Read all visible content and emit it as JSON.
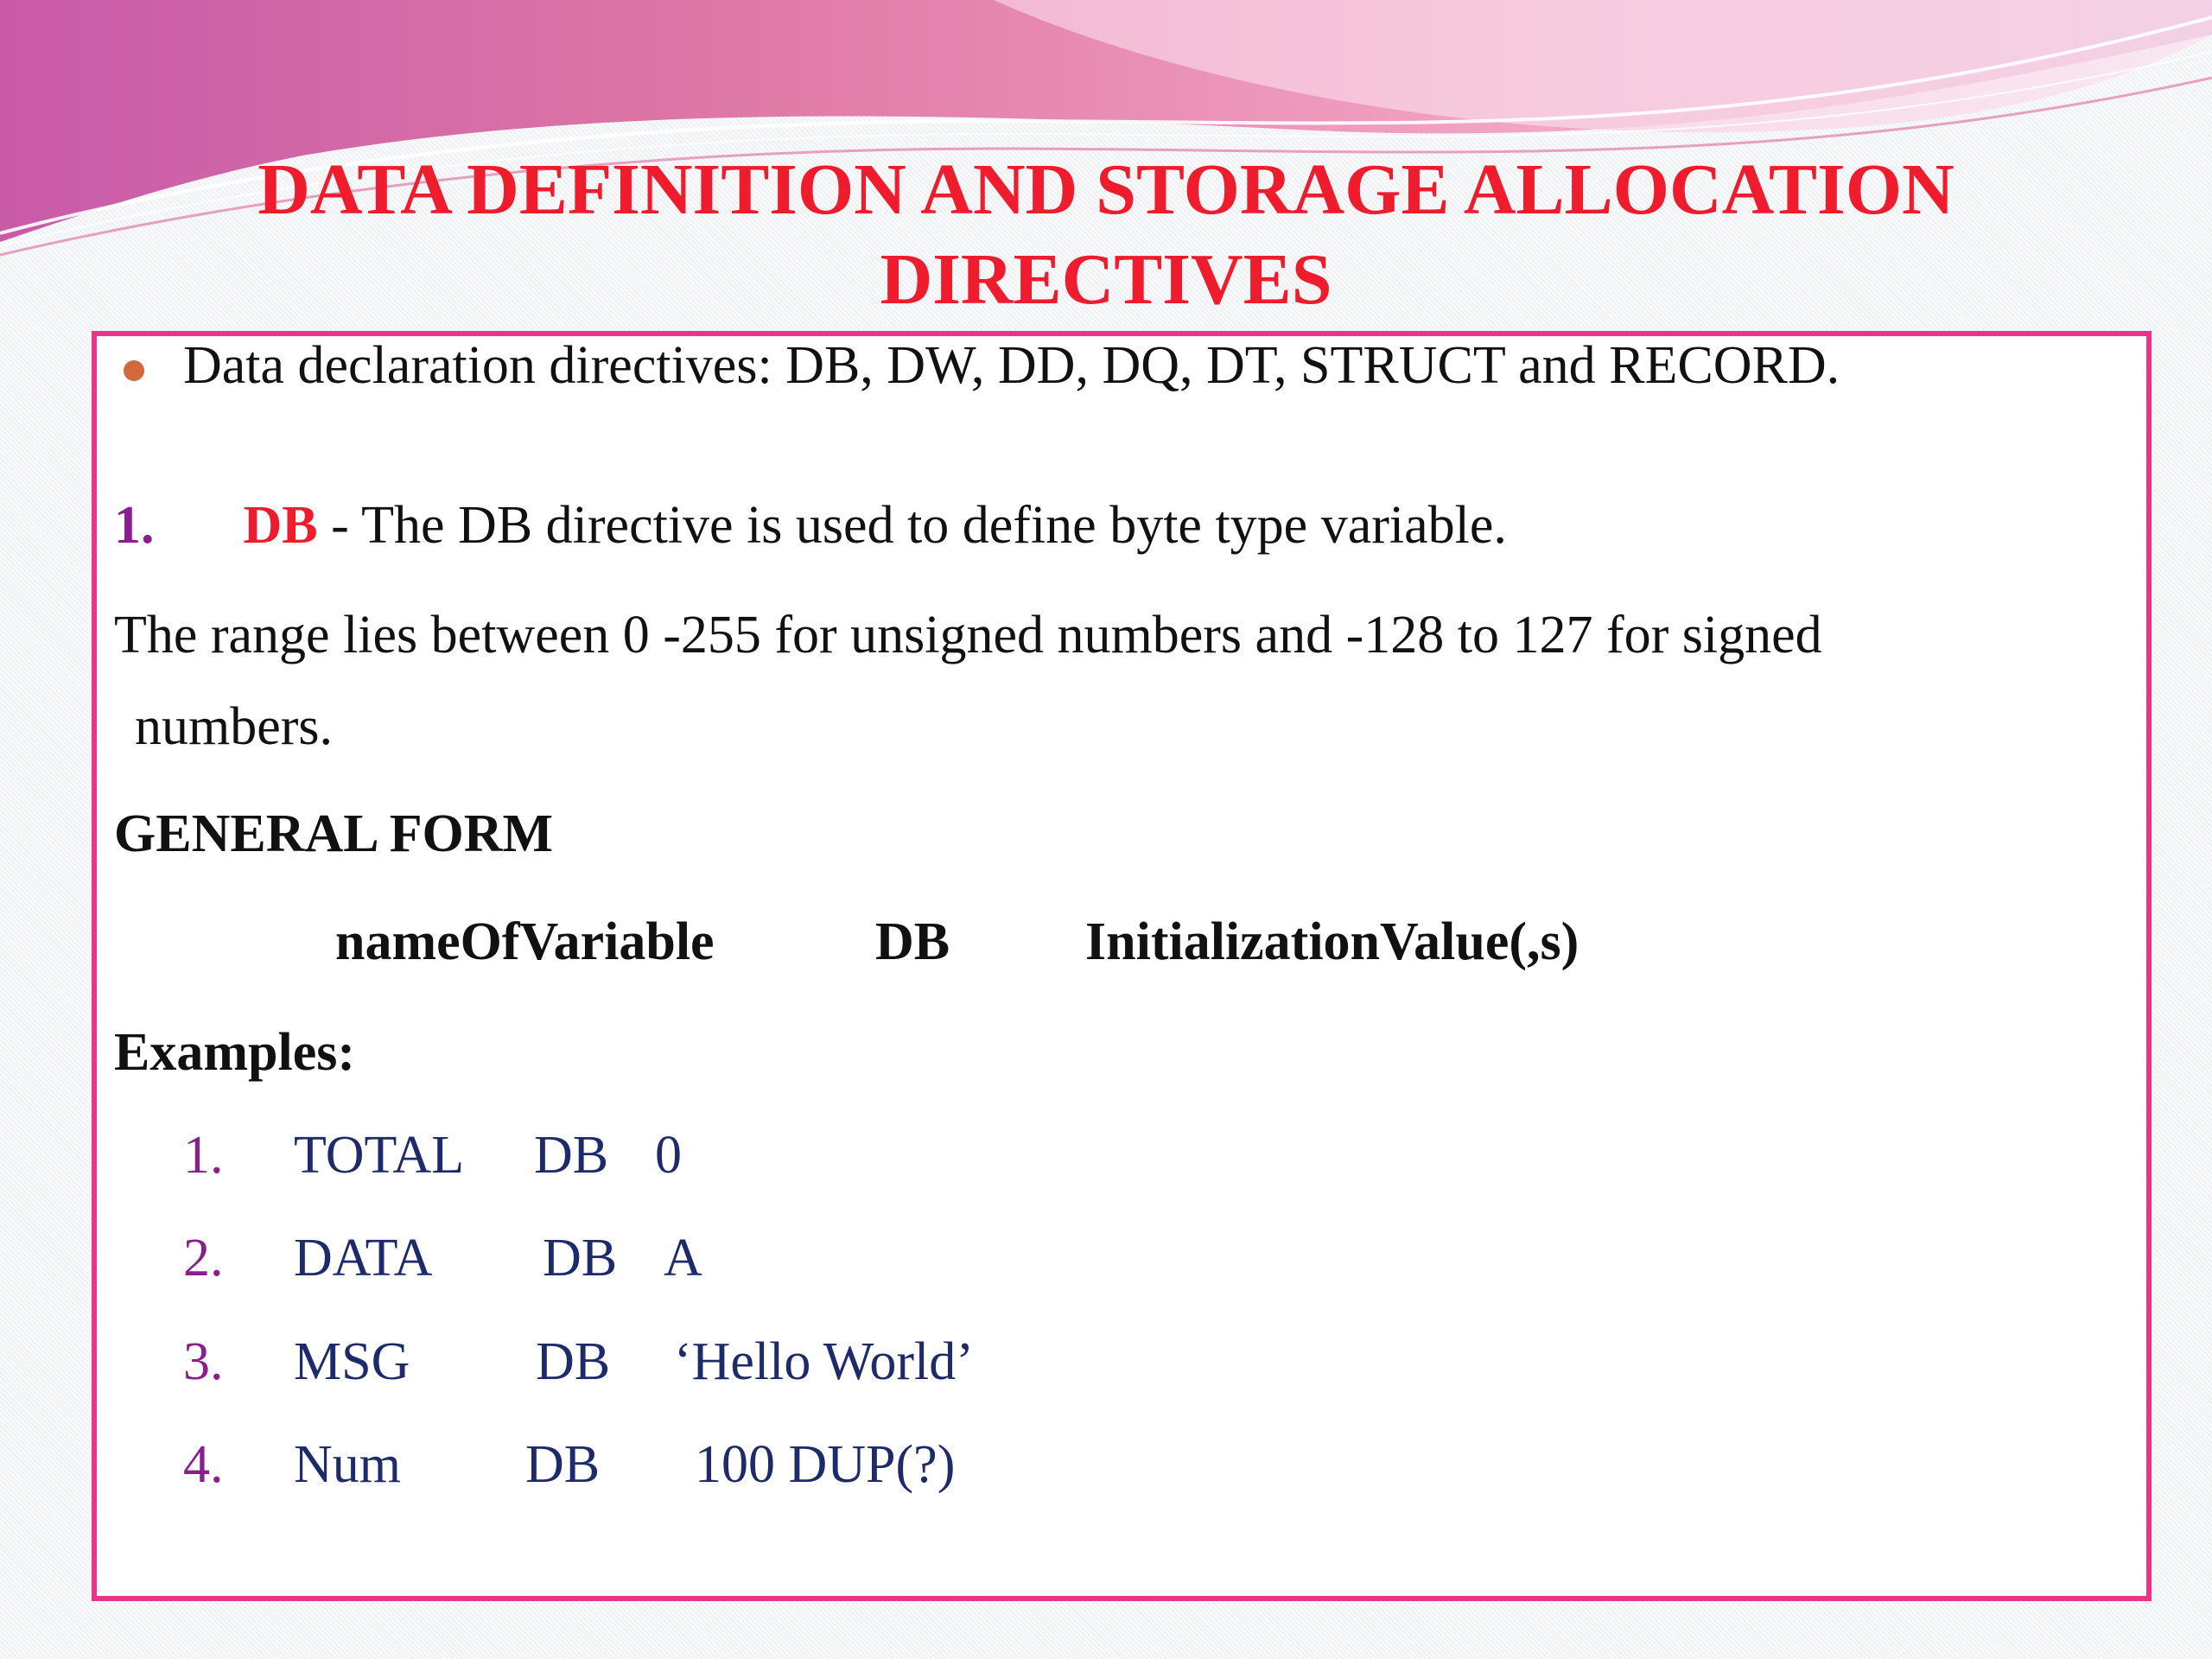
{
  "title": {
    "line1": "DATA DEFINITION AND STORAGE ALLOCATION",
    "line2": "DIRECTIVES"
  },
  "bullet": {
    "text": "Data declaration directives: DB, DW, DD, DQ, DT, STRUCT and RECORD."
  },
  "item1": {
    "number": "1.",
    "keyword": "DB",
    "description": " - The DB directive is used to define byte type variable."
  },
  "range": {
    "line1": "The range lies between 0 -255 for unsigned numbers and -128 to 127 for signed",
    "line2": "numbers."
  },
  "general_form": {
    "heading": "GENERAL FORM",
    "name": "nameOfVariable",
    "directive": "DB",
    "value": "InitializationValue(,s)"
  },
  "examples": {
    "heading": "Examples:",
    "items": [
      {
        "num": "1.",
        "name": "TOTAL",
        "directive": "DB",
        "value": "0"
      },
      {
        "num": "2.",
        "name": "DATA",
        "directive": "DB",
        "value": "A"
      },
      {
        "num": "3.",
        "name": "MSG",
        "directive": "DB",
        "value": "‘Hello World’"
      },
      {
        "num": "4.",
        "name": "Num",
        "directive": "DB",
        "value": "100 DUP(?)"
      }
    ]
  },
  "colors": {
    "title": "#ee1c2c",
    "border": "#e8358a",
    "bullet": "#d2693c",
    "number": "#8b1e8e",
    "example_text": "#1d2a6b"
  }
}
